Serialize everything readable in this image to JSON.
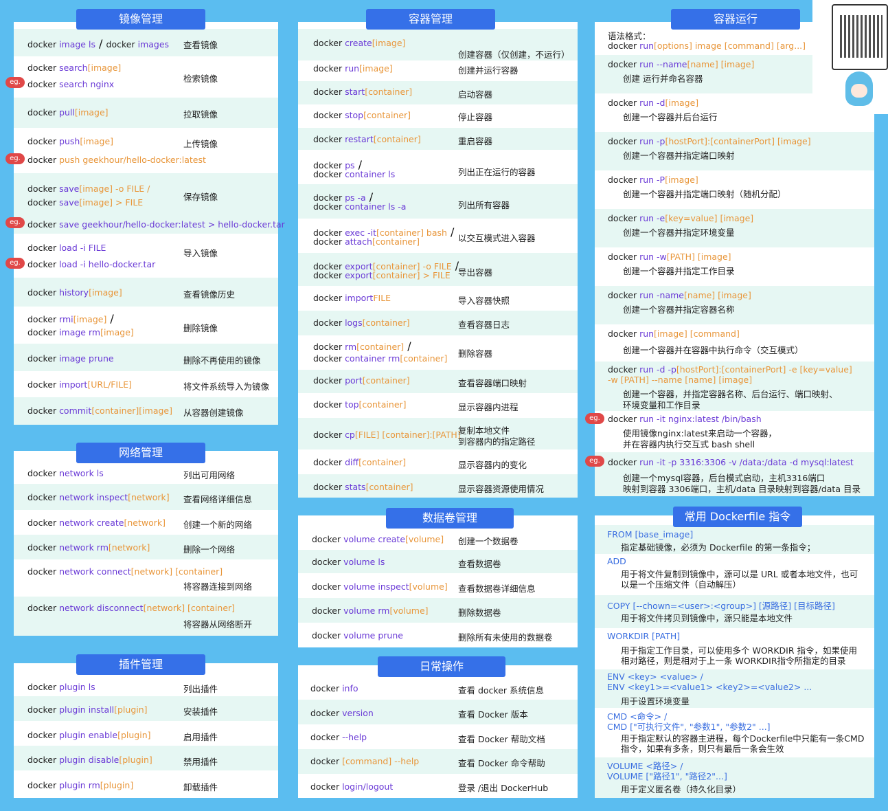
{
  "sections": {
    "image": "镜像管理",
    "container": "容器管理",
    "run": "容器运行",
    "network": "网络管理",
    "volume": "数据卷管理",
    "plugin": "插件管理",
    "daily": "日常操作",
    "dockerfile": "常用 Dockerfile 指令"
  },
  "eg": "eg.",
  "image_rows": [
    {
      "c1": "docker ",
      "c2": "image ls",
      "c3": "  /  ",
      "c4": "docker ",
      "c5": "images",
      "d": "查看镜像"
    },
    {
      "c1": "docker ",
      "c2": "search",
      "c3": "[image]",
      "d": "检索镜像",
      "e1": "docker ",
      "e2": "search nginx"
    },
    {
      "c1": "docker ",
      "c2": "pull",
      "c3": "[image]",
      "d": "拉取镜像"
    },
    {
      "c1": "docker ",
      "c2": "push",
      "c3": "[image]",
      "d": "上传镜像",
      "e1": "docker ",
      "e2": "push geekhour/hello-docker:latest"
    },
    {
      "l1a": "docker ",
      "l1b": "save",
      "l1c": "[image] -o FILE /",
      "l2a": "docker ",
      "l2b": "save",
      "l2c": "[image] > FILE",
      "d": "保存镜像",
      "e1": "docker ",
      "e2": "save geekhour/hello-docker:latest > hello-docker.tar"
    },
    {
      "c1": "docker ",
      "c2": "load -i FILE",
      "d": "导入镜像",
      "e1": "docker ",
      "e2": "load -i hello-docker.tar"
    },
    {
      "c1": "docker ",
      "c2": "history",
      "c3": "[image]",
      "d": "查看镜像历史"
    },
    {
      "l1a": "docker ",
      "l1b": "rmi",
      "l1c": "[image]",
      "l2a": "docker ",
      "l2b": "image rm",
      "l2c": "[image]",
      "d": "删除镜像"
    },
    {
      "c1": "docker ",
      "c2": "image prune",
      "d": "删除不再使用的镜像"
    },
    {
      "c1": "docker ",
      "c2": "import",
      "c3": "[URL/FILE]",
      "d": "将文件系统导入为镜像"
    },
    {
      "c1": "docker ",
      "c2": "commit",
      "c3": "[container][image]",
      "d": "从容器创建镜像"
    }
  ],
  "container_rows": [
    {
      "c1": "docker ",
      "c2": "create",
      "c3": "[image]",
      "d": "创建容器（仅创建，不运行）"
    },
    {
      "c1": "docker ",
      "c2": "run",
      "c3": "[image]",
      "d": "创建并运行容器"
    },
    {
      "c1": "docker ",
      "c2": "start",
      "c3": "[container]",
      "d": "启动容器"
    },
    {
      "c1": "docker ",
      "c2": "stop",
      "c3": "[container]",
      "d": "停止容器"
    },
    {
      "c1": "docker ",
      "c2": "restart",
      "c3": "[container]",
      "d": "重启容器"
    },
    {
      "l1a": "docker ",
      "l1b": "ps",
      "l1c": "",
      "l2a": "docker ",
      "l2b": "container ls",
      "l2c": "",
      "d": "列出正在运行的容器"
    },
    {
      "l1a": "docker ",
      "l1b": "ps -a",
      "l1c": "",
      "l2a": "docker ",
      "l2b": "container ls -a",
      "l2c": "",
      "d": "列出所有容器"
    },
    {
      "l1a": "docker ",
      "l1b": "exec -it",
      "l1c": "[container] bash",
      "l2a": "docker ",
      "l2b": "attach",
      "l2c": "[container]",
      "d": "以交互模式进入容器"
    },
    {
      "l1a": "docker ",
      "l1b": "export",
      "l1c": "[container] -o FILE",
      "l2a": "docker ",
      "l2b": "export",
      "l2c": "[container] > FILE",
      "d": "导出容器"
    },
    {
      "c1": "docker ",
      "c2": "import",
      "c3": "FILE",
      "d": "导入容器快照"
    },
    {
      "c1": "docker ",
      "c2": "logs",
      "c3": "[container]",
      "d": "查看容器日志"
    },
    {
      "l1a": "docker ",
      "l1b": "rm",
      "l1c": "[container]",
      "l2a": "docker ",
      "l2b": "container rm",
      "l2c": "[container]",
      "d": "删除容器"
    },
    {
      "c1": "docker ",
      "c2": "port",
      "c3": "[container]",
      "d": "查看容器端口映射"
    },
    {
      "c1": "docker ",
      "c2": "top",
      "c3": "[container]",
      "d": "显示容器内进程"
    },
    {
      "c1": "docker ",
      "c2": "cp",
      "c3": "[FILE] [container]:[PATH]",
      "d": "复制本地文件",
      "d2": "到容器内的指定路径"
    },
    {
      "c1": "docker ",
      "c2": "diff",
      "c3": "[container]",
      "d": "显示容器内的变化"
    },
    {
      "c1": "docker ",
      "c2": "stats",
      "c3": "[container]",
      "d": "显示容器资源使用情况"
    }
  ],
  "run_rows": [
    {
      "pre": "语法格式：",
      "a": "docker ",
      "b": "run",
      "c": "[options] image [command] [arg...]"
    },
    {
      "a": "docker ",
      "b": "run --name",
      "c": "[name] [image]",
      "d": "创建 运行并命名容器"
    },
    {
      "a": "docker ",
      "b": "run -d",
      "c": "[image]",
      "d": "创建一个容器并后台运行"
    },
    {
      "a": "docker ",
      "b": "run  -p",
      "c": "[hostPort]:[containerPort] [image]",
      "d": "创建一个容器并指定端口映射"
    },
    {
      "a": "docker ",
      "b": "run -P",
      "c": "[image]",
      "d": "创建一个容器并指定端口映射（随机分配）"
    },
    {
      "a": "docker ",
      "b": "run  -e",
      "c": "[key=value] [image]",
      "d": "创建一个容器并指定环境变量"
    },
    {
      "a": "docker ",
      "b": "run -w",
      "c": "[PATH] [image]",
      "d": "创建一个容器并指定工作目录"
    },
    {
      "a": "docker ",
      "b": "run  -name",
      "c": "[name] [image]",
      "d": "创建一个容器并指定容器名称"
    },
    {
      "a": "docker ",
      "b": "run",
      "c": "[image] [command]",
      "d": "创建一个容器并在容器中执行命令（交互模式）"
    }
  ],
  "run_complex": {
    "l1a": "docker ",
    "l1b": "run  -d -p",
    "l1c": "[hostPort]:[containerPort] -e [key=value]",
    "l2": "-w [PATH] --name [name] [image]",
    "d1": "创建一个容器，并指定容器名称、后台运行、端口映射、",
    "d2": "环境变量和工作目录"
  },
  "run_eg1": {
    "a": "docker ",
    "b": "run -it nginx:latest /bin/bash",
    "d1": "使用镜像nginx:latest来启动一个容器，",
    "d2": "并在容器内执行交互式 bash shell"
  },
  "run_eg2": {
    "a": "docker ",
    "b": "run  -it -p 3316:3306 -v /data:/data -d mysql:latest",
    "d1": "创建一个mysql容器，后台模式启动，主机3316端口",
    "d2": "映射到容器 3306端口，主机/data 目录映射到容器/data 目录"
  },
  "network_rows": [
    {
      "c1": "docker ",
      "c2": "network ls",
      "d": "列出可用网络"
    },
    {
      "c1": "docker ",
      "c2": "network inspect",
      "c3": "[network]",
      "d": "查看网络详细信息"
    },
    {
      "c1": "docker ",
      "c2": "network create",
      "c3": "[network]",
      "d": "创建一个新的网络"
    },
    {
      "c1": "docker ",
      "c2": "network rm",
      "c3": "[network]",
      "d": "删除一个网络"
    },
    {
      "c1": "docker ",
      "c2": "network connect",
      "c3": "[network] [container]",
      "d": "将容器连接到网络"
    },
    {
      "c1": "docker ",
      "c2": "network disconnect",
      "c3": "[network] [container]",
      "d": "将容器从网络断开"
    }
  ],
  "volume_rows": [
    {
      "c1": "docker ",
      "c2": "volume create",
      "c3": "[volume]",
      "d": "创建一个数据卷"
    },
    {
      "c1": "docker ",
      "c2": "volume ls",
      "d": "查看数据卷"
    },
    {
      "c1": "docker ",
      "c2": "volume inspect",
      "c3": "[volume]",
      "d": "查看数据卷详细信息"
    },
    {
      "c1": "docker ",
      "c2": "volume rm",
      "c3": "[volume]",
      "d": "删除数据卷"
    },
    {
      "c1": "docker ",
      "c2": "volume prune",
      "d": "删除所有未使用的数据卷"
    }
  ],
  "plugin_rows": [
    {
      "c1": "docker ",
      "c2": "plugin ls",
      "d": "列出插件"
    },
    {
      "c1": "docker ",
      "c2": "plugin install",
      "c3": "[plugin]",
      "d": "安装插件"
    },
    {
      "c1": "docker ",
      "c2": "plugin enable",
      "c3": "[plugin]",
      "d": "启用插件"
    },
    {
      "c1": "docker ",
      "c2": "plugin disable",
      "c3": "[plugin]",
      "d": "禁用插件"
    },
    {
      "c1": "docker ",
      "c2": "plugin rm",
      "c3": "[plugin]",
      "d": "卸载插件"
    }
  ],
  "daily_rows": [
    {
      "c1": "docker ",
      "c2": "info",
      "d": "查看 docker 系统信息"
    },
    {
      "c1": "docker ",
      "c2": "version",
      "d": "查看 Docker 版本"
    },
    {
      "c1": "docker ",
      "c2": "--help",
      "d": "查看 Docker 帮助文档"
    },
    {
      "c1": "docker ",
      "c2": "[command] --help",
      "d": "查看 Docker 命令帮助"
    },
    {
      "c1": "docker ",
      "c2": "login/logout",
      "d": "登录 /退出 DockerHub"
    }
  ],
  "dockerfile_rows": [
    {
      "c": "FROM [base_image]",
      "d1": "指定基础镜像，必须为 Dockerfile 的第一条指令；"
    },
    {
      "c": "ADD",
      "d1": "用于将文件复制到镜像中，源可以是 URL 或者本地文件，也可",
      "d2": "以是一个压缩文件（自动解压）"
    },
    {
      "c": "COPY [--chown=<user>:<group>] [源路径] [目标路径]",
      "d1": "用于将文件拷贝到镜像中，源只能是本地文件"
    },
    {
      "c": "WORKDIR [PATH]",
      "d1": "用于指定工作目录，可以使用多个 WORKDIR 指令，如果使用",
      "d2": "相对路径，则是相对于上一条 WORKDIR指令所指定的目录"
    },
    {
      "c": "ENV <key> <value>   /",
      "c2": "ENV <key1>=<value1> <key2>=<value2> ...",
      "d1": "用于设置环境变量"
    },
    {
      "c": "CMD <命令> /",
      "c2": "CMD [\"可执行文件\", \"参数1\", \"参数2\" ...]",
      "d1": "用于指定默认的容器主进程，每个Dockerfile中只能有一条CMD",
      "d2": "指令，如果有多条，则只有最后一条会生效"
    },
    {
      "c": "VOLUME <路径>  /",
      "c2": "VOLUME [\"路径1\", \"路径2\"...]",
      "d1": "用于定义匿名卷（持久化目录）"
    }
  ]
}
